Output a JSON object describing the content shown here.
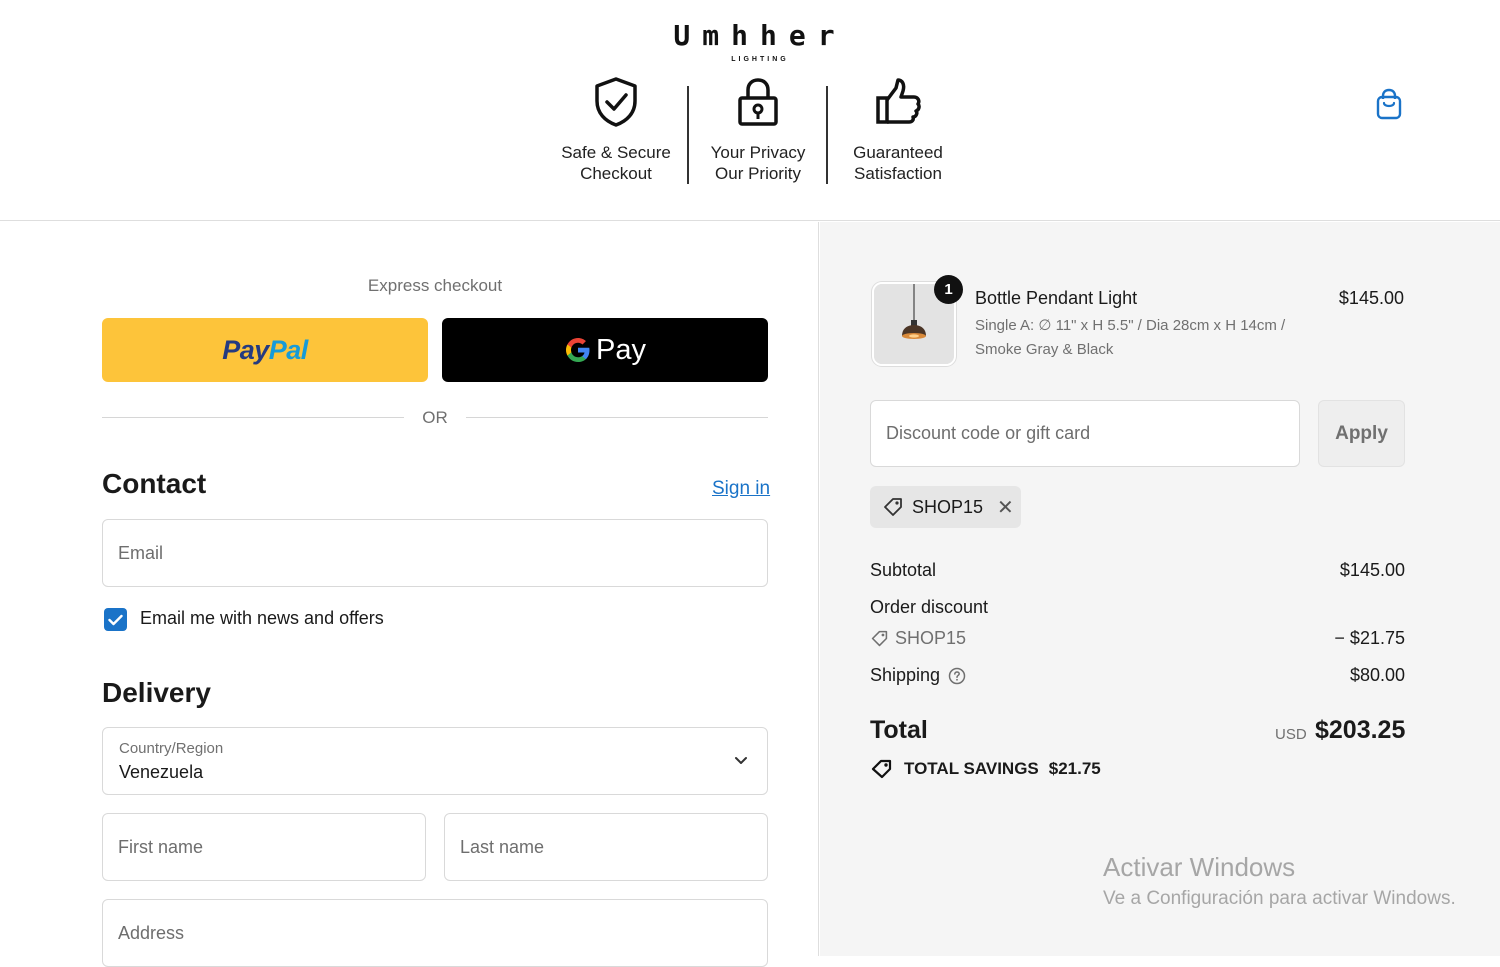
{
  "header": {
    "logo_word": "Umhher",
    "logo_sub": "LIGHTING",
    "badges": [
      {
        "line1": "Safe & Secure",
        "line2": "Checkout",
        "icon": "shield-check-icon"
      },
      {
        "line1": "Your Privacy",
        "line2": "Our Priority",
        "icon": "padlock-icon"
      },
      {
        "line1": "Guaranteed",
        "line2": "Satisfaction",
        "icon": "thumbs-up-icon"
      }
    ],
    "cart_icon": "shopping-bag-icon"
  },
  "express": {
    "label": "Express checkout",
    "paypal_label": "PayPal",
    "gpay_label": "Pay",
    "or_label": "OR"
  },
  "contact": {
    "heading": "Contact",
    "sign_in": "Sign in",
    "email_placeholder": "Email",
    "newsletter_label": "Email me with news and offers",
    "newsletter_checked": true
  },
  "delivery": {
    "heading": "Delivery",
    "country_label": "Country/Region",
    "country_value": "Venezuela",
    "first_name_placeholder": "First name",
    "last_name_placeholder": "Last name",
    "address_placeholder": "Address"
  },
  "summary": {
    "product": {
      "quantity": "1",
      "name": "Bottle Pendant Light",
      "variant": "Single A: ∅ 11\" x H 5.5\" / Dia 28cm x H 14cm / Smoke Gray & Black",
      "price": "$145.00"
    },
    "discount_placeholder": "Discount code or gift card",
    "apply_label": "Apply",
    "applied_code": "SHOP15",
    "subtotal_label": "Subtotal",
    "subtotal_value": "$145.00",
    "order_discount_label": "Order discount",
    "discount_code": "SHOP15",
    "discount_value": "− $21.75",
    "shipping_label": "Shipping",
    "shipping_value": "$80.00",
    "total_label": "Total",
    "total_currency": "USD",
    "total_value": "$203.25",
    "savings_label": "TOTAL SAVINGS",
    "savings_value": "$21.75"
  },
  "watermark": {
    "line1": "Activar Windows",
    "line2": "Ve a Configuración para activar Windows."
  },
  "colors": {
    "accent": "#1a73c8",
    "paypal_yellow": "#fdc43a",
    "paypal_blue_dark": "#253b80",
    "paypal_blue_light": "#179bd7",
    "summary_bg": "#f5f5f5"
  }
}
